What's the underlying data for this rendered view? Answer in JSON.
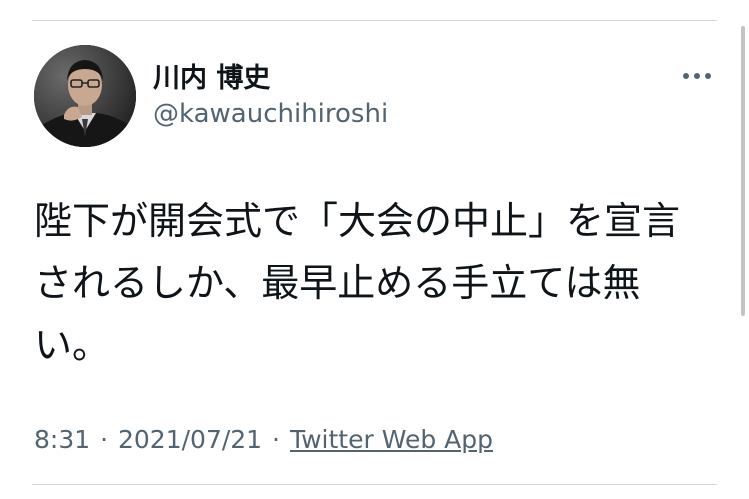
{
  "user": {
    "display_name": "川内 博史",
    "handle": "@kawauchihiroshi"
  },
  "tweet": {
    "text": "陛下が開会式で「大会の中止」を宣言されるしか、最早止める手立ては無い。",
    "time": "8:31",
    "separator": "·",
    "date": "2021/07/21",
    "source": "Twitter Web App"
  },
  "icons": {
    "more": "more-horizontal-icon",
    "avatar": "profile-photo"
  },
  "colors": {
    "text_primary": "#0f1419",
    "text_secondary": "#536471",
    "divider": "#cfd9de"
  }
}
